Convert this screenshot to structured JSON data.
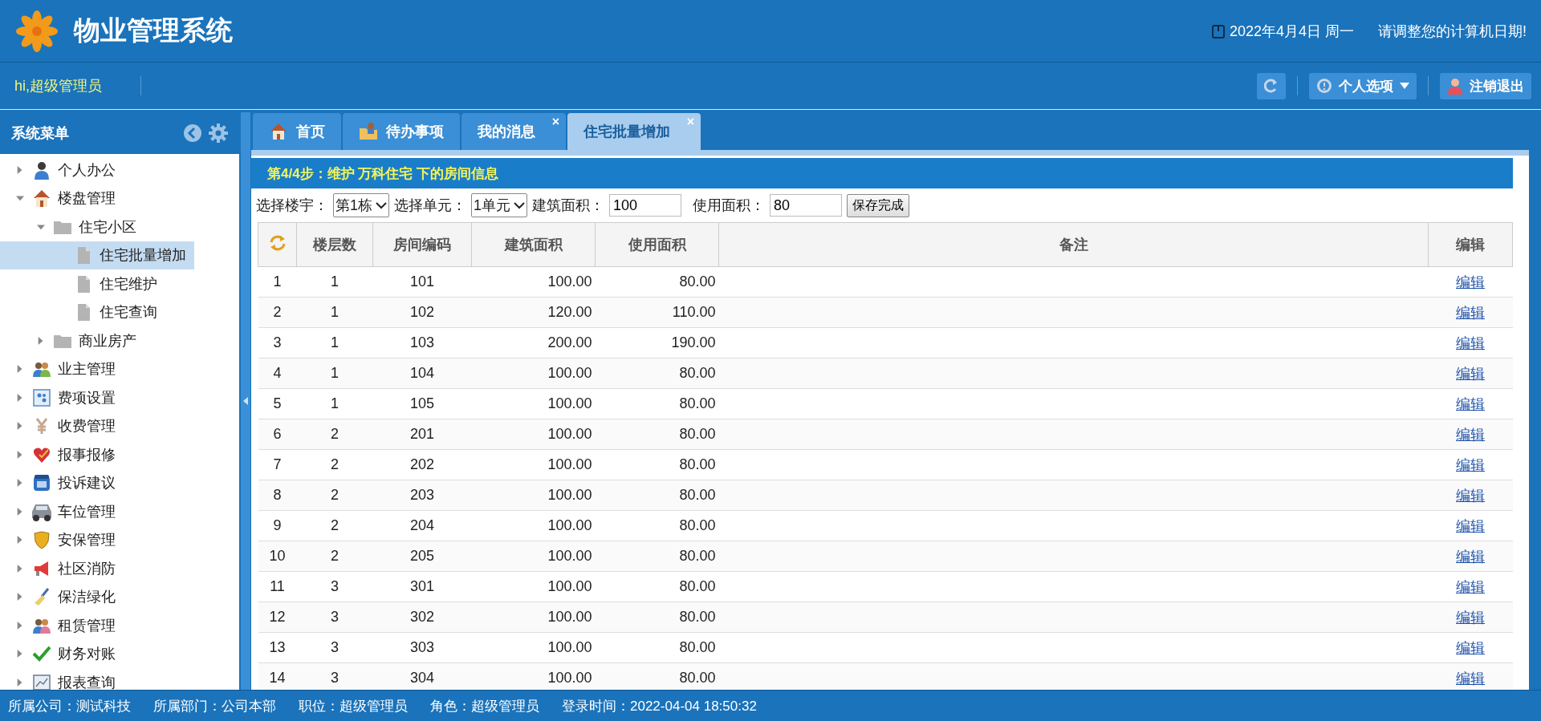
{
  "header": {
    "title": "物业管理系统",
    "date": "2022年4月4日 周一",
    "notice": "请调整您的计算机日期!"
  },
  "user_bar": {
    "greeting": "hi,超级管理员",
    "buttons": [
      {
        "kind": "refresh"
      },
      {
        "label": "个人选项",
        "kind": "menu"
      },
      {
        "label": "注销退出",
        "kind": "logout"
      }
    ]
  },
  "sidebar": {
    "title": "系统菜单",
    "items": [
      {
        "label": "个人办公",
        "expanded": false,
        "selected": false
      },
      {
        "label": "楼盘管理",
        "expanded": true,
        "selected": false,
        "children": [
          {
            "label": "住宅小区",
            "expanded": true,
            "selected": false,
            "children": [
              {
                "label": "住宅批量增加",
                "selected": true
              },
              {
                "label": "住宅维护",
                "selected": false
              },
              {
                "label": "住宅查询",
                "selected": false
              }
            ]
          },
          {
            "label": "商业房产",
            "expanded": false,
            "selected": false
          }
        ]
      },
      {
        "label": "业主管理",
        "expanded": false,
        "selected": false
      },
      {
        "label": "费项设置",
        "expanded": false,
        "selected": false
      },
      {
        "label": "收费管理",
        "expanded": false,
        "selected": false
      },
      {
        "label": "报事报修",
        "expanded": false,
        "selected": false
      },
      {
        "label": "投诉建议",
        "expanded": false,
        "selected": false
      },
      {
        "label": "车位管理",
        "expanded": false,
        "selected": false
      },
      {
        "label": "安保管理",
        "expanded": false,
        "selected": false
      },
      {
        "label": "社区消防",
        "expanded": false,
        "selected": false
      },
      {
        "label": "保洁绿化",
        "expanded": false,
        "selected": false
      },
      {
        "label": "租赁管理",
        "expanded": false,
        "selected": false
      },
      {
        "label": "财务对账",
        "expanded": false,
        "selected": false
      },
      {
        "label": "报表查询",
        "expanded": false,
        "selected": false
      }
    ]
  },
  "tabs": [
    {
      "label": "首页",
      "selected": false,
      "closable": false
    },
    {
      "label": "待办事项",
      "selected": false,
      "closable": false
    },
    {
      "label": "我的消息",
      "selected": false,
      "closable": true,
      "close": "×"
    },
    {
      "label": "住宅批量增加",
      "selected": true,
      "closable": true,
      "close": "×"
    }
  ],
  "panel": {
    "title": "第4/4步：维护 万科住宅 下的房间信息",
    "form": {
      "building_label": "选择楼宇：",
      "building": "第1栋",
      "unit_label": "选择单元：",
      "unit": "1单元",
      "area_label": "建筑面积：",
      "area": "100",
      "use_area_label": "使用面积：",
      "use_area": "80",
      "save": "保存完成"
    },
    "table": {
      "columns": [
        "楼层数",
        "房间编码",
        "建筑面积",
        "使用面积",
        "备注",
        "编辑"
      ],
      "rows": [
        {
          "no": "1",
          "cells": [
            "1",
            "101",
            "100.00",
            "80.00"
          ],
          "edit": "编辑"
        },
        {
          "no": "2",
          "cells": [
            "1",
            "102",
            "120.00",
            "110.00"
          ],
          "edit": "编辑"
        },
        {
          "no": "3",
          "cells": [
            "1",
            "103",
            "200.00",
            "190.00"
          ],
          "edit": "编辑"
        },
        {
          "no": "4",
          "cells": [
            "1",
            "104",
            "100.00",
            "80.00"
          ],
          "edit": "编辑"
        },
        {
          "no": "5",
          "cells": [
            "1",
            "105",
            "100.00",
            "80.00"
          ],
          "edit": "编辑"
        },
        {
          "no": "6",
          "cells": [
            "2",
            "201",
            "100.00",
            "80.00"
          ],
          "edit": "编辑"
        },
        {
          "no": "7",
          "cells": [
            "2",
            "202",
            "100.00",
            "80.00"
          ],
          "edit": "编辑"
        },
        {
          "no": "8",
          "cells": [
            "2",
            "203",
            "100.00",
            "80.00"
          ],
          "edit": "编辑"
        },
        {
          "no": "9",
          "cells": [
            "2",
            "204",
            "100.00",
            "80.00"
          ],
          "edit": "编辑"
        },
        {
          "no": "10",
          "cells": [
            "2",
            "205",
            "100.00",
            "80.00"
          ],
          "edit": "编辑"
        },
        {
          "no": "11",
          "cells": [
            "3",
            "301",
            "100.00",
            "80.00"
          ],
          "edit": "编辑"
        },
        {
          "no": "12",
          "cells": [
            "3",
            "302",
            "100.00",
            "80.00"
          ],
          "edit": "编辑"
        },
        {
          "no": "13",
          "cells": [
            "3",
            "303",
            "100.00",
            "80.00"
          ],
          "edit": "编辑"
        },
        {
          "no": "14",
          "cells": [
            "3",
            "304",
            "100.00",
            "80.00"
          ],
          "edit": "编辑"
        }
      ]
    }
  },
  "status_bar": [
    "所属公司：测试科技",
    "所属部门：公司本部",
    "职位：超级管理员",
    "角色：超级管理员",
    "登录时间：2022-04-04 18:50:32"
  ]
}
